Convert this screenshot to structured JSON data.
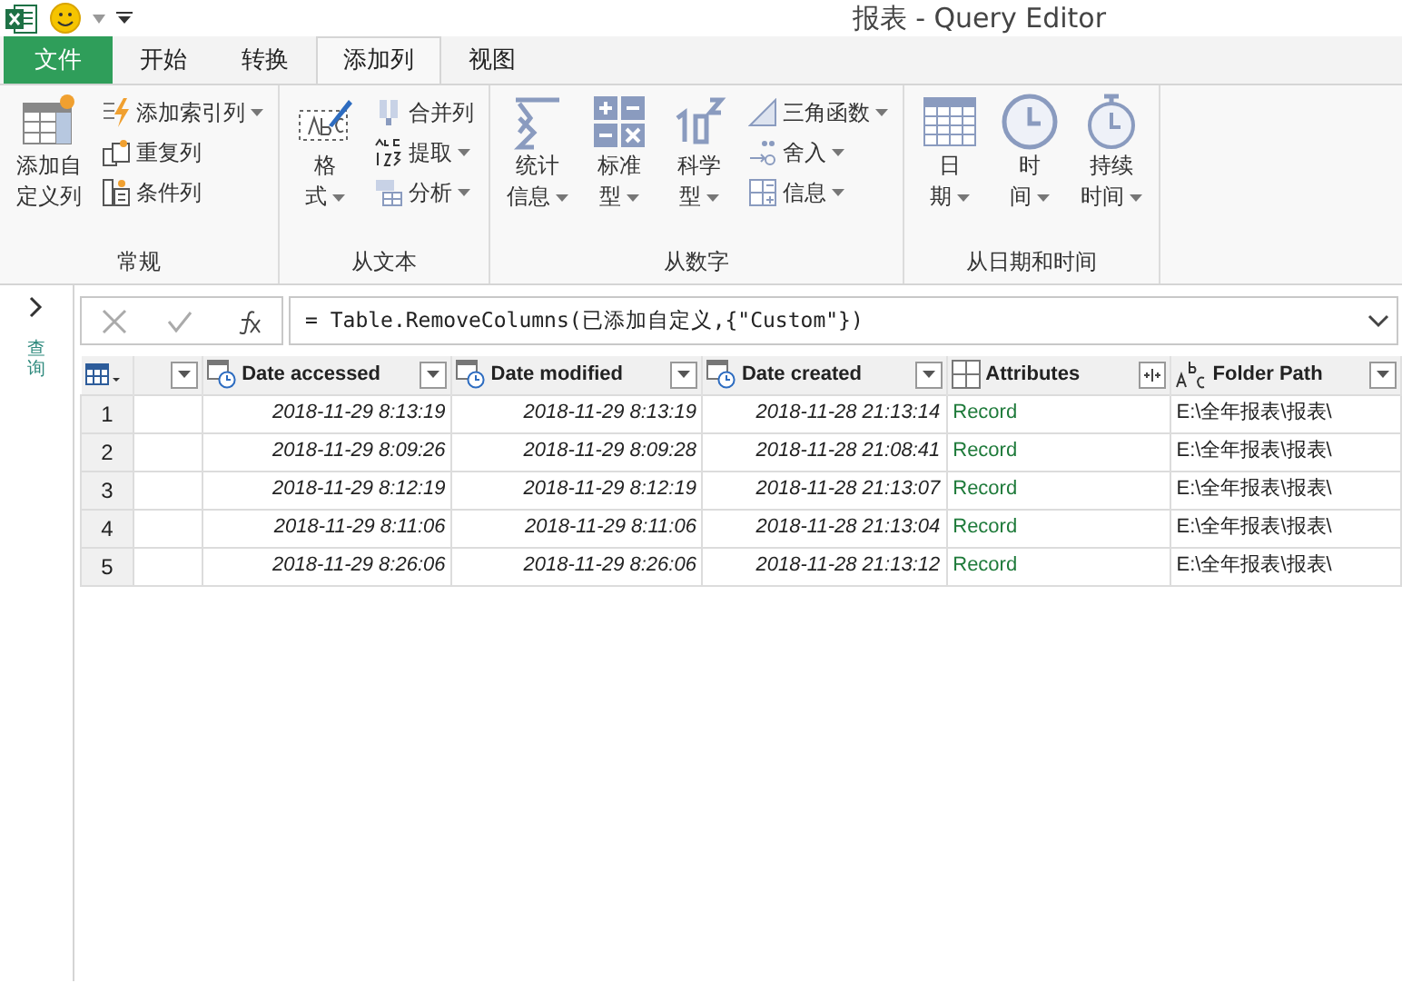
{
  "window": {
    "title": "报表 - Query Editor"
  },
  "tabs": [
    {
      "label": "文件",
      "kind": "file",
      "selected": false
    },
    {
      "label": "开始",
      "kind": "tab",
      "selected": false
    },
    {
      "label": "转换",
      "kind": "tab",
      "selected": false
    },
    {
      "label": "添加列",
      "kind": "tab",
      "selected": true
    },
    {
      "label": "视图",
      "kind": "tab",
      "selected": false
    }
  ],
  "ribbon": {
    "groups": [
      {
        "label": "常规",
        "items": [
          {
            "lines": [
              "添加自",
              "定义列"
            ],
            "kind": "large",
            "dropdown": false
          },
          {
            "label": "添加索引列",
            "kind": "small",
            "dropdown": true
          },
          {
            "label": "重复列",
            "kind": "small",
            "dropdown": false
          },
          {
            "label": "条件列",
            "kind": "small",
            "dropdown": false
          }
        ]
      },
      {
        "label": "从文本",
        "items": [
          {
            "lines": [
              "格",
              "式"
            ],
            "kind": "large",
            "dropdown": true
          },
          {
            "label": "合并列",
            "kind": "small",
            "dropdown": false
          },
          {
            "label": "提取",
            "kind": "small",
            "dropdown": true
          },
          {
            "label": "分析",
            "kind": "small",
            "dropdown": true
          }
        ]
      },
      {
        "label": "从数字",
        "items": [
          {
            "lines": [
              "统计",
              "信息"
            ],
            "kind": "large",
            "dropdown": true
          },
          {
            "lines": [
              "标准",
              "型"
            ],
            "kind": "large",
            "dropdown": true
          },
          {
            "lines": [
              "科学",
              "型"
            ],
            "kind": "large",
            "dropdown": true
          },
          {
            "label": "三角函数",
            "kind": "small",
            "dropdown": true
          },
          {
            "label": "舍入",
            "kind": "small",
            "dropdown": true
          },
          {
            "label": "信息",
            "kind": "small",
            "dropdown": true
          }
        ]
      },
      {
        "label": "从日期和时间",
        "items": [
          {
            "lines": [
              "日",
              "期"
            ],
            "kind": "large",
            "dropdown": true
          },
          {
            "lines": [
              "时",
              "间"
            ],
            "kind": "large",
            "dropdown": true
          },
          {
            "lines": [
              "持续",
              "时间"
            ],
            "kind": "large",
            "dropdown": true
          }
        ]
      }
    ]
  },
  "query_pane": {
    "label": "查询"
  },
  "formula_bar": {
    "text": "= Table.RemoveColumns(已添加自定义,{\"Custom\"})"
  },
  "table": {
    "columns": [
      {
        "kind": "blank"
      },
      {
        "label": "Date accessed",
        "kind": "datetime"
      },
      {
        "label": "Date modified",
        "kind": "datetime"
      },
      {
        "label": "Date created",
        "kind": "datetime"
      },
      {
        "label": "Attributes",
        "kind": "record"
      },
      {
        "label": "Folder Path",
        "kind": "text"
      }
    ],
    "rows": [
      {
        "index": "1",
        "cells": [
          "",
          "2018-11-29 8:13:19",
          "2018-11-29 8:13:19",
          "2018-11-28 21:13:14",
          "Record",
          "E:\\全年报表\\报表\\"
        ]
      },
      {
        "index": "2",
        "cells": [
          "",
          "2018-11-29 8:09:26",
          "2018-11-29 8:09:28",
          "2018-11-28 21:08:41",
          "Record",
          "E:\\全年报表\\报表\\"
        ]
      },
      {
        "index": "3",
        "cells": [
          "",
          "2018-11-29 8:12:19",
          "2018-11-29 8:12:19",
          "2018-11-28 21:13:07",
          "Record",
          "E:\\全年报表\\报表\\"
        ]
      },
      {
        "index": "4",
        "cells": [
          "",
          "2018-11-29 8:11:06",
          "2018-11-29 8:11:06",
          "2018-11-28 21:13:04",
          "Record",
          "E:\\全年报表\\报表\\"
        ]
      },
      {
        "index": "5",
        "cells": [
          "",
          "2018-11-29 8:26:06",
          "2018-11-29 8:26:06",
          "2018-11-28 21:13:12",
          "Record",
          "E:\\全年报表\\报表\\"
        ]
      }
    ]
  }
}
